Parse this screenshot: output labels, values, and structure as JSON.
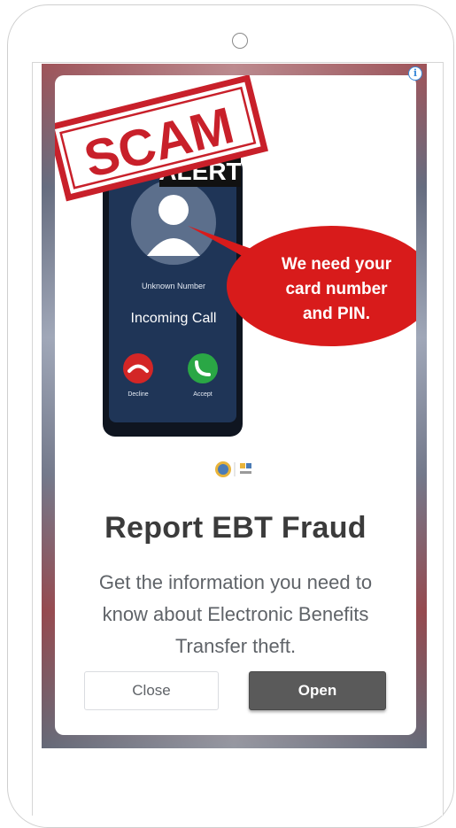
{
  "ad": {
    "image": {
      "stamp_text": "SCAM",
      "alert_text": "ALERT",
      "caller_label": "Unknown Number",
      "call_status": "Incoming Call",
      "decline_label": "Decline",
      "accept_label": "Accept",
      "bubble_line1": "We need your",
      "bubble_line2": "card number",
      "bubble_line3": "and PIN."
    },
    "headline": "Report EBT Fraud",
    "description": "Get the information you need to know about Electronic Benefits Transfer theft.",
    "close_label": "Close",
    "open_label": "Open",
    "info_icon": "info-icon"
  },
  "colors": {
    "stamp_red": "#c8202a",
    "bubble_red": "#d81b1b",
    "phone_navy": "#1f3557",
    "accept_green": "#2aa745",
    "open_button": "#5a5a5a"
  }
}
